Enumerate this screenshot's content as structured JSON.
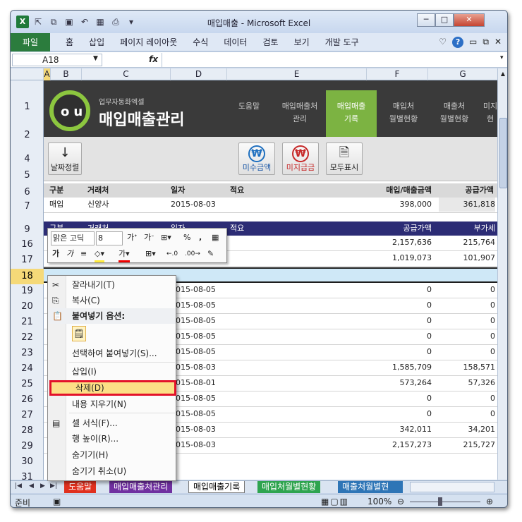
{
  "window": {
    "title": "매입매출 - Microsoft Excel",
    "app_icon": "X",
    "controls": {
      "minimize": "─",
      "restore": "□",
      "close": "✕"
    }
  },
  "ribbon": {
    "file_tab": "파일",
    "tabs": [
      "홈",
      "삽입",
      "페이지 레이아웃",
      "수식",
      "데이터",
      "검토",
      "보기",
      "개발 도구"
    ]
  },
  "formula_bar": {
    "name_box": "A18",
    "fx": "fx",
    "value": ""
  },
  "columns": [
    "A",
    "B",
    "C",
    "D",
    "E",
    "F",
    "G"
  ],
  "rows": [
    "1",
    "2",
    "4",
    "5",
    "6",
    "7",
    "9",
    "16",
    "17",
    "18",
    "19",
    "20",
    "21",
    "22",
    "23",
    "24",
    "25",
    "26",
    "27",
    "28",
    "29",
    "30",
    "31"
  ],
  "banner": {
    "subtitle": "업무자동화엑셀",
    "title": "매입매출관리",
    "logo_text": "ou",
    "nav": [
      {
        "line1": "도움말",
        "line2": ""
      },
      {
        "line1": "매입매출처",
        "line2": "관리"
      },
      {
        "line1": "매입매출",
        "line2": "기록"
      },
      {
        "line1": "매입처",
        "line2": "월별현황"
      },
      {
        "line1": "매출처",
        "line2": "월별현황"
      },
      {
        "line1": "미지",
        "line2": "현"
      }
    ]
  },
  "buttons": {
    "sort": "날짜정렬",
    "unpaid": "미수금액",
    "payable": "미지급금",
    "show_all": "모두표시"
  },
  "summary": {
    "headers": {
      "type": "구분",
      "vendor": "거래처",
      "date": "일자",
      "memo": "적요",
      "amount": "매입/매출금액",
      "supply": "공급가액"
    },
    "row": {
      "type": "매입",
      "vendor": "신양사",
      "date": "2015-08-03",
      "memo": "",
      "amount": "398,000",
      "supply": "361,818"
    }
  },
  "table": {
    "headers": {
      "type": "구분",
      "vendor": "거래처",
      "date": "일자",
      "memo": "적요",
      "supply": "공급가액",
      "vat": "부가세"
    },
    "rows": [
      {
        "date": "",
        "supply": "2,157,636",
        "vat": "215,764"
      },
      {
        "date": "",
        "supply": "1,019,073",
        "vat": "101,907"
      },
      {
        "date": "",
        "supply": "",
        "vat": ""
      },
      {
        "date": "2015-08-05",
        "supply": "0",
        "vat": "0"
      },
      {
        "date": "2015-08-05",
        "supply": "0",
        "vat": "0"
      },
      {
        "date": "2015-08-05",
        "supply": "0",
        "vat": "0"
      },
      {
        "date": "2015-08-05",
        "supply": "0",
        "vat": "0"
      },
      {
        "date": "2015-08-05",
        "supply": "0",
        "vat": "0"
      },
      {
        "date": "2015-08-03",
        "supply": "1,585,709",
        "vat": "158,571"
      },
      {
        "date": "2015-08-01",
        "supply": "573,264",
        "vat": "57,326"
      },
      {
        "date": "2015-08-05",
        "supply": "0",
        "vat": "0"
      },
      {
        "date": "2015-08-05",
        "supply": "0",
        "vat": "0"
      },
      {
        "date": "2015-08-03",
        "supply": "342,011",
        "vat": "34,201"
      },
      {
        "date": "2015-08-03",
        "supply": "2,157,273",
        "vat": "215,727"
      }
    ]
  },
  "mini_toolbar": {
    "font": "맑은 고딕",
    "size": "8",
    "percent": "%",
    "comma": ","
  },
  "context_menu": {
    "cut": "잘라내기(T)",
    "copy": "복사(C)",
    "paste_options": "붙여넣기 옵션:",
    "paste_special": "선택하여 붙여넣기(S)...",
    "insert": "삽입(I)",
    "delete": "삭제(D)",
    "clear": "내용 지우기(N)",
    "format": "셀 서식(F)...",
    "row_height": "행 높이(R)...",
    "hide": "숨기기(H)",
    "unhide": "숨기기 취소(U)"
  },
  "sheet_tabs": [
    "도움말",
    "매입매출처관리",
    "매입매출기록",
    "매입처월별현황",
    "매출처월별현"
  ],
  "status": {
    "ready": "준비",
    "zoom": "100%"
  },
  "colors": {
    "banner": "#3a3a3a",
    "active_nav": "#7cb342",
    "table_header": "#2c2c75",
    "highlight_border": "#e3122a",
    "file_tab": "#2b7c3d"
  }
}
